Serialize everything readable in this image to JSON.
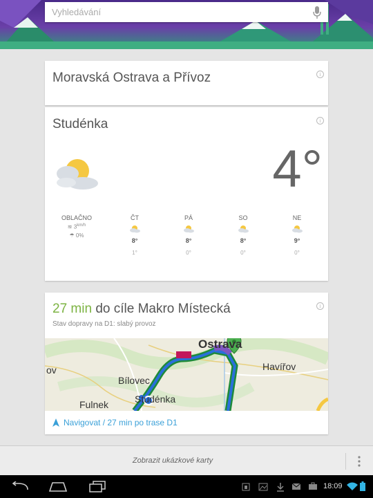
{
  "search": {
    "placeholder": "Vyhledávání"
  },
  "location_card": {
    "title": "Moravská Ostrava a Přívoz"
  },
  "weather_card": {
    "title": "Studénka",
    "temperature": "4°",
    "current": {
      "label": "OBLAČNO",
      "wind": "3",
      "wind_unit": "km/h",
      "precip": "0%"
    },
    "days": [
      {
        "label": "ČT",
        "high": "8°",
        "low": "1°"
      },
      {
        "label": "PÁ",
        "high": "8°",
        "low": "0°"
      },
      {
        "label": "SO",
        "high": "8°",
        "low": "0°"
      },
      {
        "label": "NE",
        "high": "9°",
        "low": "0°"
      }
    ]
  },
  "route_card": {
    "minutes": "27 min",
    "destination": "do cíle Makro Místecká",
    "traffic": "Stav dopravy na D1: slabý provoz",
    "map_labels": {
      "ostrava": "Ostrava",
      "havirov": "Havířov",
      "bilovec": "Bílovec",
      "studenka": "Studénka",
      "fulnek": "Fulnek",
      "kov": "ov"
    },
    "navigate": "Navigovat / 27 min po trase D1"
  },
  "bottom": {
    "show_cards": "Zobrazit ukázkové karty"
  },
  "status": {
    "time": "18:09"
  },
  "colors": {
    "accent_green": "#7cb342",
    "link_blue": "#3aa0d8",
    "route_green": "#2ea043",
    "route_blue": "#2a6fdb"
  }
}
